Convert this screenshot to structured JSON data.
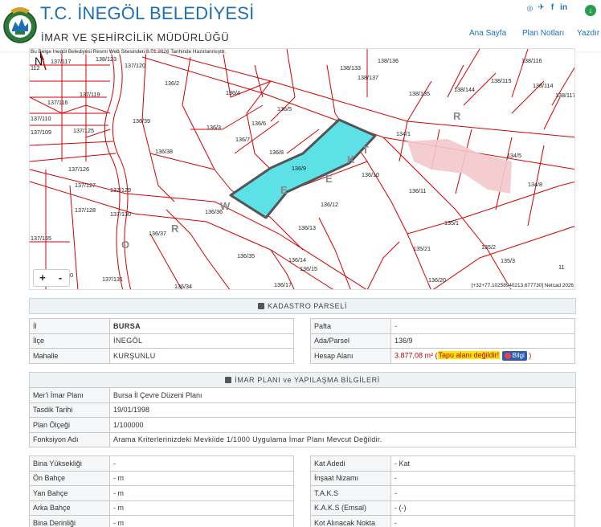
{
  "header": {
    "title": "T.C. İNEGÖL BELEDİYESİ",
    "subtitle": "İMAR VE ŞEHİRCİLİK MÜDÜRLÜĞÜ",
    "nav": [
      "Ana Sayfa",
      "Plan Notları",
      "Yazdır"
    ],
    "social_icons": [
      "instagram-icon",
      "twitter-icon",
      "facebook-icon",
      "linkedin-icon",
      "download-icon"
    ],
    "accent_color": "#1d6fb4"
  },
  "map": {
    "note": "Bu Belge İnegöl Belediyesi Resmi Web Sitesinden 8.01.2026 Tarihinde Hazırlanmıştır.",
    "coords": "[+32+77.10258940213.677730] Netcad 2026",
    "zoom_in": "+",
    "zoom_out": "-",
    "north": "N",
    "highlight_color": "#5ce1e6",
    "parcel_line_color": "#d60000",
    "road_letters": [
      "R",
      "E",
      "K",
      "T",
      "O",
      "R",
      "W",
      "E"
    ],
    "parcel_labels": [
      "137/117",
      "138/123",
      "138/133",
      "138/137",
      "138/116",
      "112",
      "137/119",
      "137/120",
      "136/2",
      "138/136",
      "138/115",
      "138/114",
      "137/116",
      "136/4",
      "138/135",
      "138/144",
      "138/117",
      "137/110",
      "136/39",
      "136/5",
      "136/6",
      "136/3",
      "137/109",
      "137/125",
      "136/7",
      "136/8",
      "134/1",
      "134/5",
      "136/38",
      "137/126",
      "136/9",
      "136/10",
      "134/8",
      "137/127",
      "137/129",
      "136/11",
      "136/36",
      "136/12",
      "137/128",
      "137/130",
      "135/1",
      "137/165",
      "136/37",
      "136/13",
      "135/2",
      "136/35",
      "136/14",
      "136/15",
      "135/21",
      "135/3",
      "137/131",
      "136/34",
      "136/17",
      "136/20",
      "11",
      "10"
    ]
  },
  "kadastro": {
    "title": "KADASTRO PARSELİ",
    "left_rows": [
      {
        "label": "İl",
        "value": "BURSA"
      },
      {
        "label": "İlçe",
        "value": "İNEGÖL"
      },
      {
        "label": "Mahalle",
        "value": "KURŞUNLU"
      }
    ],
    "right_rows": [
      {
        "label": "Pafta",
        "value": "-"
      },
      {
        "label": "Ada/Parsel",
        "value": "136/9"
      },
      {
        "label": "Hesap Alanı",
        "value": "3.877,08 m²"
      }
    ],
    "area_warning": "Tapu alanı değildir!",
    "info_button": "Bilgi",
    "paren_open": " (",
    "paren_close": " )"
  },
  "imar": {
    "title": "İMAR PLANI ve YAPILAŞMA BİLGİLERİ",
    "rows": [
      {
        "label": "Mer'i İmar Planı",
        "value": "Bursa İl Çevre Düzeni Planı"
      },
      {
        "label": "Tasdik Tarihi",
        "value": "19/01/1998"
      },
      {
        "label": "Plan Ölçeği",
        "value": "1/100000"
      },
      {
        "label": "Fonksiyon Adı",
        "value": "Arama Kriterlerinizdeki Mevkiide 1/1000 Uygulama İmar Planı Mevcut Değildir."
      }
    ]
  },
  "yapilasma": {
    "left_rows": [
      {
        "label": "Bina Yüksekliği",
        "value": "-"
      },
      {
        "label": "Ön Bahçe",
        "value": "- m"
      },
      {
        "label": "Yan Bahçe",
        "value": "- m"
      },
      {
        "label": "Arka Bahçe",
        "value": "- m"
      },
      {
        "label": "Bina Derinliği",
        "value": "- m"
      }
    ],
    "right_rows": [
      {
        "label": "Kat Adedi",
        "value": "- Kat"
      },
      {
        "label": "İnşaat Nizamı",
        "value": "-"
      },
      {
        "label": "T.A.K.S",
        "value": "-"
      },
      {
        "label": "K.A.K.S (Emsal)",
        "value": "- (-)"
      },
      {
        "label": "Kot Alınacak Nokta",
        "value": "-"
      }
    ]
  }
}
